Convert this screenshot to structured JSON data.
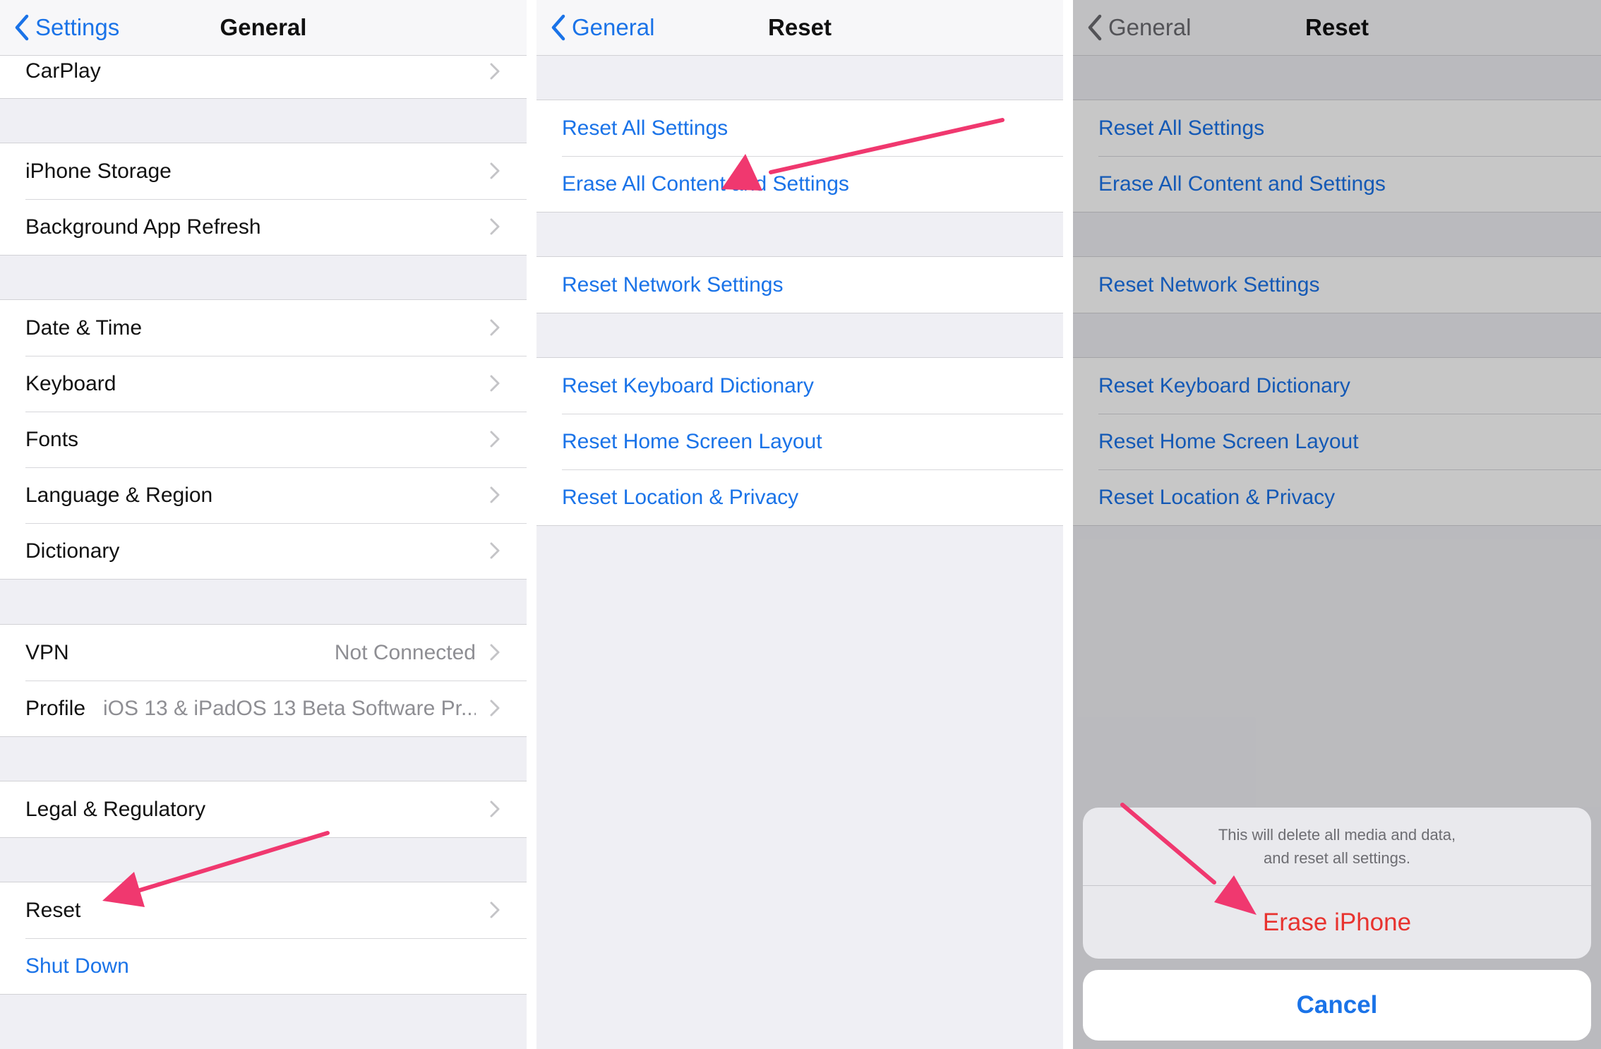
{
  "colors": {
    "accent": "#1a73e8",
    "destructive": "#e8332f",
    "annotation": "#f0386f"
  },
  "general": {
    "back_label": "Settings",
    "title": "General",
    "groups": [
      [
        {
          "label": "CarPlay"
        }
      ],
      [
        {
          "label": "iPhone Storage"
        },
        {
          "label": "Background App Refresh"
        }
      ],
      [
        {
          "label": "Date & Time"
        },
        {
          "label": "Keyboard"
        },
        {
          "label": "Fonts"
        },
        {
          "label": "Language & Region"
        },
        {
          "label": "Dictionary"
        }
      ],
      [
        {
          "label": "VPN",
          "value": "Not Connected"
        },
        {
          "label": "Profile",
          "value": "iOS 13 & iPadOS 13 Beta Software Pr..."
        }
      ],
      [
        {
          "label": "Legal & Regulatory"
        }
      ],
      [
        {
          "label": "Reset"
        },
        {
          "label": "Shut Down"
        }
      ]
    ]
  },
  "reset": {
    "back_label": "General",
    "title": "Reset",
    "groups": [
      [
        {
          "label": "Reset All Settings"
        },
        {
          "label": "Erase All Content and Settings"
        }
      ],
      [
        {
          "label": "Reset Network Settings"
        }
      ],
      [
        {
          "label": "Reset Keyboard Dictionary"
        },
        {
          "label": "Reset Home Screen Layout"
        },
        {
          "label": "Reset Location & Privacy"
        }
      ]
    ]
  },
  "confirm_sheet": {
    "message_line1": "This will delete all media and data,",
    "message_line2": "and reset all settings.",
    "erase_label": "Erase iPhone",
    "cancel_label": "Cancel"
  }
}
